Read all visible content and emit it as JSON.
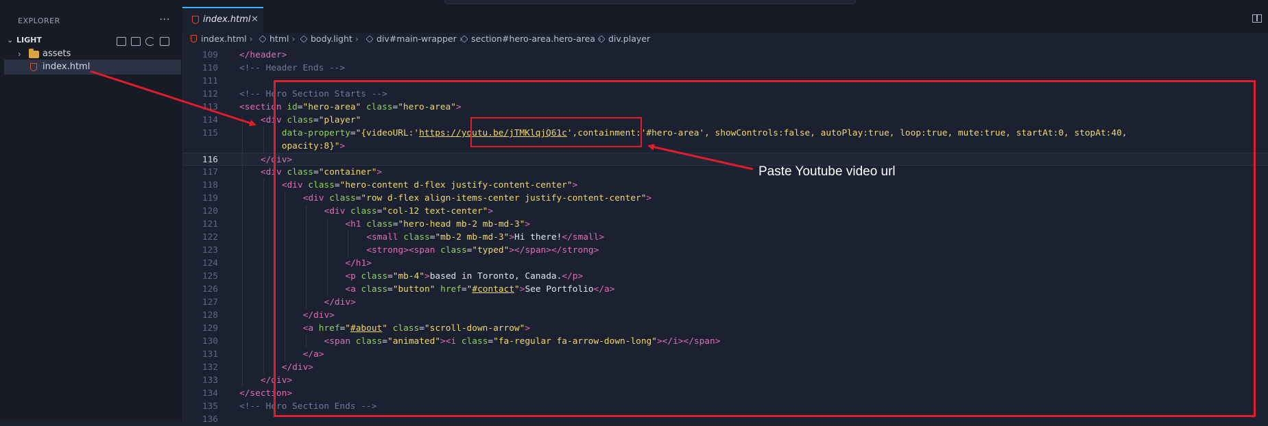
{
  "sidebar": {
    "title": "EXPLORER",
    "more_icon": "ellipsis-icon",
    "root_label": "LIGHT",
    "items": [
      {
        "label": "assets",
        "icon": "folder-icon"
      },
      {
        "label": "index.html",
        "icon": "html5-icon"
      }
    ]
  },
  "tab": {
    "label": "index.html",
    "close": "✕"
  },
  "breadcrumb": [
    "index.html",
    "html",
    "body.light",
    "div#main-wrapper",
    "section#hero-area.hero-area",
    "div.player"
  ],
  "editor": {
    "current_line": 116,
    "lines": [
      {
        "n": "109",
        "indent": 1,
        "tokens": [
          [
            "tag",
            "</header>"
          ]
        ]
      },
      {
        "n": "110",
        "indent": 1,
        "tokens": [
          [
            "cm",
            "<!-- Header Ends -->"
          ]
        ]
      },
      {
        "n": "111",
        "indent": 0,
        "tokens": []
      },
      {
        "n": "112",
        "indent": 1,
        "tokens": [
          [
            "cm",
            "<!-- Hero Section Starts -->"
          ]
        ]
      },
      {
        "n": "113",
        "indent": 1,
        "tokens": [
          [
            "tag",
            "<section "
          ],
          [
            "attr",
            "id"
          ],
          [
            "txt",
            "="
          ],
          [
            "str",
            "\"hero-area\" "
          ],
          [
            "attr",
            "class"
          ],
          [
            "txt",
            "="
          ],
          [
            "str",
            "\"hero-area\""
          ],
          [
            "tag",
            ">"
          ]
        ]
      },
      {
        "n": "114",
        "indent": 2,
        "tokens": [
          [
            "tag",
            "<div "
          ],
          [
            "attr",
            "class"
          ],
          [
            "txt",
            "="
          ],
          [
            "str",
            "\"player\""
          ]
        ]
      },
      {
        "n": "115",
        "indent": 3,
        "tokens": [
          [
            "attr",
            "data-property"
          ],
          [
            "txt",
            "="
          ],
          [
            "str",
            "\"{videoURL:'"
          ],
          [
            "strlink",
            "https://youtu.be/jTMKlqjQ61c"
          ],
          [
            "str",
            "',containment:'#hero-area', showControls:false, autoPlay:true, loop:true, mute:true, startAt:0, stopAt:40,"
          ]
        ]
      },
      {
        "n": "",
        "indent": 3,
        "tokens": [
          [
            "str",
            "opacity:8}\""
          ],
          [
            "tag",
            ">"
          ]
        ]
      },
      {
        "n": "116",
        "indent": 2,
        "tokens": [
          [
            "tag",
            "</div>"
          ]
        ]
      },
      {
        "n": "117",
        "indent": 2,
        "tokens": [
          [
            "tag",
            "<div "
          ],
          [
            "attr",
            "class"
          ],
          [
            "txt",
            "="
          ],
          [
            "str",
            "\"container\""
          ],
          [
            "tag",
            ">"
          ]
        ]
      },
      {
        "n": "118",
        "indent": 3,
        "tokens": [
          [
            "tag",
            "<div "
          ],
          [
            "attr",
            "class"
          ],
          [
            "txt",
            "="
          ],
          [
            "str",
            "\"hero-content d-flex justify-content-center\""
          ],
          [
            "tag",
            ">"
          ]
        ]
      },
      {
        "n": "119",
        "indent": 4,
        "tokens": [
          [
            "tag",
            "<div "
          ],
          [
            "attr",
            "class"
          ],
          [
            "txt",
            "="
          ],
          [
            "str",
            "\"row d-flex align-items-center justify-content-center\""
          ],
          [
            "tag",
            ">"
          ]
        ]
      },
      {
        "n": "120",
        "indent": 5,
        "tokens": [
          [
            "tag",
            "<div "
          ],
          [
            "attr",
            "class"
          ],
          [
            "txt",
            "="
          ],
          [
            "str",
            "\"col-12 text-center\""
          ],
          [
            "tag",
            ">"
          ]
        ]
      },
      {
        "n": "121",
        "indent": 6,
        "tokens": [
          [
            "tag",
            "<h1 "
          ],
          [
            "attr",
            "class"
          ],
          [
            "txt",
            "="
          ],
          [
            "str",
            "\"hero-head mb-2 mb-md-3\""
          ],
          [
            "tag",
            ">"
          ]
        ]
      },
      {
        "n": "122",
        "indent": 7,
        "tokens": [
          [
            "tag",
            "<small "
          ],
          [
            "attr",
            "class"
          ],
          [
            "txt",
            "="
          ],
          [
            "str",
            "\"mb-2 mb-md-3\""
          ],
          [
            "tag",
            ">"
          ],
          [
            "txt",
            "Hi there!"
          ],
          [
            "tag",
            "</small>"
          ]
        ]
      },
      {
        "n": "123",
        "indent": 7,
        "tokens": [
          [
            "tag",
            "<strong><span "
          ],
          [
            "attr",
            "class"
          ],
          [
            "txt",
            "="
          ],
          [
            "str",
            "\"typed\""
          ],
          [
            "tag",
            "></span></strong>"
          ]
        ]
      },
      {
        "n": "124",
        "indent": 6,
        "tokens": [
          [
            "tag",
            "</h1>"
          ]
        ]
      },
      {
        "n": "125",
        "indent": 6,
        "tokens": [
          [
            "tag",
            "<p "
          ],
          [
            "attr",
            "class"
          ],
          [
            "txt",
            "="
          ],
          [
            "str",
            "\"mb-4\""
          ],
          [
            "tag",
            ">"
          ],
          [
            "txt",
            "based in Toronto, Canada."
          ],
          [
            "tag",
            "</p>"
          ]
        ]
      },
      {
        "n": "126",
        "indent": 6,
        "tokens": [
          [
            "tag",
            "<a "
          ],
          [
            "attr",
            "class"
          ],
          [
            "txt",
            "="
          ],
          [
            "str",
            "\"button\" "
          ],
          [
            "attr",
            "href"
          ],
          [
            "txt",
            "="
          ],
          [
            "str",
            "\""
          ],
          [
            "strlink",
            "#contact"
          ],
          [
            "str",
            "\""
          ],
          [
            "tag",
            ">"
          ],
          [
            "txt",
            "See Portfolio"
          ],
          [
            "tag",
            "</a>"
          ]
        ]
      },
      {
        "n": "127",
        "indent": 5,
        "tokens": [
          [
            "tag",
            "</div>"
          ]
        ]
      },
      {
        "n": "128",
        "indent": 4,
        "tokens": [
          [
            "tag",
            "</div>"
          ]
        ]
      },
      {
        "n": "129",
        "indent": 4,
        "tokens": [
          [
            "tag",
            "<a "
          ],
          [
            "attr",
            "href"
          ],
          [
            "txt",
            "="
          ],
          [
            "str",
            "\""
          ],
          [
            "strlink",
            "#about"
          ],
          [
            "str",
            "\" "
          ],
          [
            "attr",
            "class"
          ],
          [
            "txt",
            "="
          ],
          [
            "str",
            "\"scroll-down-arrow\""
          ],
          [
            "tag",
            ">"
          ]
        ]
      },
      {
        "n": "130",
        "indent": 5,
        "tokens": [
          [
            "tag",
            "<span "
          ],
          [
            "attr",
            "class"
          ],
          [
            "txt",
            "="
          ],
          [
            "str",
            "\"animated\""
          ],
          [
            "tag",
            "><i "
          ],
          [
            "attr",
            "class"
          ],
          [
            "txt",
            "="
          ],
          [
            "str",
            "\"fa-regular fa-arrow-down-long\""
          ],
          [
            "tag",
            "></i></span>"
          ]
        ]
      },
      {
        "n": "131",
        "indent": 4,
        "tokens": [
          [
            "tag",
            "</a>"
          ]
        ]
      },
      {
        "n": "132",
        "indent": 3,
        "tokens": [
          [
            "tag",
            "</div>"
          ]
        ]
      },
      {
        "n": "133",
        "indent": 2,
        "tokens": [
          [
            "tag",
            "</div>"
          ]
        ]
      },
      {
        "n": "134",
        "indent": 1,
        "tokens": [
          [
            "tag",
            "</section>"
          ]
        ]
      },
      {
        "n": "135",
        "indent": 1,
        "tokens": [
          [
            "cm",
            "<!-- Hero Section Ends -->"
          ]
        ]
      },
      {
        "n": "136",
        "indent": 0,
        "tokens": []
      }
    ]
  },
  "annotations": {
    "callout_text": "Paste Youtube video url",
    "color": "#e11d2b"
  },
  "colors": {
    "tag": "#e06fb0",
    "attr": "#8fd35c",
    "string": "#f1d86a",
    "comment": "#6b7a9c",
    "accent": "#35b9ff"
  }
}
